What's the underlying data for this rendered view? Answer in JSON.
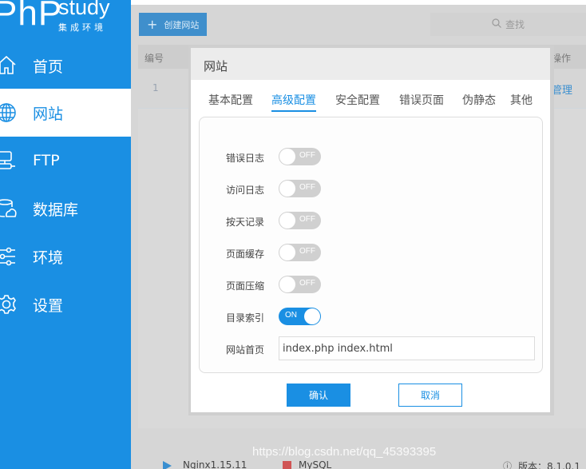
{
  "app": {
    "logo_main": "PhP",
    "logo_study": "study",
    "logo_sub": "集成环境"
  },
  "sidebar": {
    "items": [
      {
        "label": "首页",
        "icon": "home-icon",
        "active": false
      },
      {
        "label": "网站",
        "icon": "globe-icon",
        "active": true
      },
      {
        "label": "FTP",
        "icon": "ftp-icon",
        "active": false
      },
      {
        "label": "数据库",
        "icon": "database-icon",
        "active": false
      },
      {
        "label": "环境",
        "icon": "sliders-icon",
        "active": false
      },
      {
        "label": "设置",
        "icon": "gear-icon",
        "active": false
      }
    ]
  },
  "toolbar": {
    "create_label": "创建网站",
    "search_placeholder": "查找"
  },
  "table": {
    "columns": {
      "number": "编号",
      "actions": "操作"
    },
    "rows": [
      {
        "number": "1",
        "action": "管理"
      }
    ]
  },
  "modal": {
    "title": "网站",
    "tabs": [
      {
        "label": "基本配置",
        "active": false
      },
      {
        "label": "高级配置",
        "active": true
      },
      {
        "label": "安全配置",
        "active": false
      },
      {
        "label": "错误页面",
        "active": false
      },
      {
        "label": "伪静态",
        "active": false
      },
      {
        "label": "其他",
        "active": false
      }
    ],
    "settings": [
      {
        "label": "错误日志",
        "state": "OFF",
        "on": false
      },
      {
        "label": "访问日志",
        "state": "OFF",
        "on": false
      },
      {
        "label": "按天记录",
        "state": "OFF",
        "on": false
      },
      {
        "label": "页面缓存",
        "state": "OFF",
        "on": false
      },
      {
        "label": "页面压缩",
        "state": "OFF",
        "on": false
      },
      {
        "label": "目录索引",
        "state": "ON",
        "on": true
      }
    ],
    "homepage": {
      "label": "网站首页",
      "value": "index.php index.html"
    },
    "confirm_label": "确认",
    "cancel_label": "取消"
  },
  "statusbar": {
    "nginx": "Nginx1.15.11",
    "mysql": "MySQL",
    "version": "版本：8.1.0.1",
    "colors": {
      "running": "#3a8fd0",
      "stopped": "#d05555"
    }
  },
  "watermark": "https://blog.csdn.net/qq_45393395",
  "colors": {
    "accent": "#1a8fe3"
  }
}
